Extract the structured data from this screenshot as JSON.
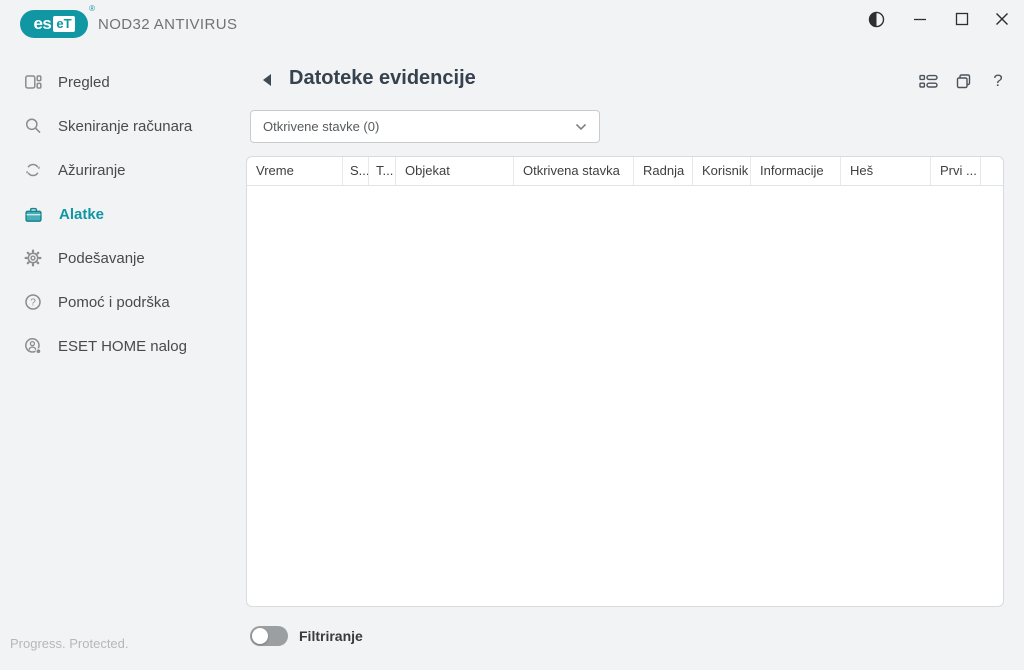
{
  "topbar": {
    "logo": {
      "part1": "es",
      "part2": "eT",
      "registered": "®"
    },
    "product_name": "NOD32 ANTIVIRUS"
  },
  "sidebar": {
    "items": [
      {
        "label": "Pregled",
        "icon": "overview-icon",
        "active": false
      },
      {
        "label": "Skeniranje računara",
        "icon": "computer-scan-icon",
        "active": false
      },
      {
        "label": "Ažuriranje",
        "icon": "update-icon",
        "active": false
      },
      {
        "label": "Alatke",
        "icon": "tools-icon",
        "active": true
      },
      {
        "label": "Podešavanje",
        "icon": "settings-icon",
        "active": false
      },
      {
        "label": "Pomoć i podrška",
        "icon": "help-icon",
        "active": false
      },
      {
        "label": "ESET HOME nalog",
        "icon": "account-icon",
        "active": false
      }
    ],
    "status": "Progress. Protected."
  },
  "main": {
    "title": "Datoteke evidencije",
    "dropdown": {
      "value": "Otkrivene stavke (0)"
    },
    "table": {
      "columns": [
        "Vreme",
        "S...",
        "T...",
        "Objekat",
        "Otkrivena stavka",
        "Radnja",
        "Korisnik",
        "Informacije",
        "Heš",
        "Prvi ...",
        ""
      ],
      "rows": []
    },
    "toggle": {
      "label": "Filtriranje",
      "state": "off"
    }
  },
  "icons": {
    "help_glyph": "?"
  },
  "colors": {
    "accent": "#1097a3",
    "title": "#36424e",
    "sidebar_text": "#4a4a4a",
    "muted": "#b5b7b9"
  }
}
